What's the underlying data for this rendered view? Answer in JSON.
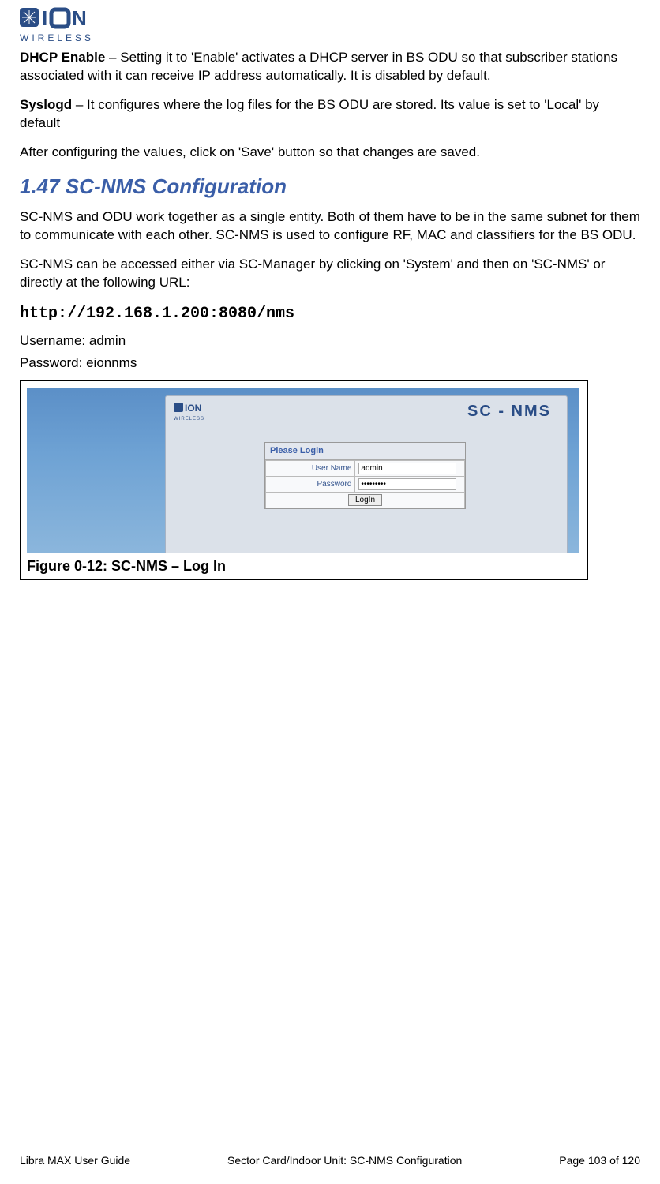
{
  "logo": {
    "brand_top": "EION",
    "brand_sub": "WIRELESS"
  },
  "body": {
    "p1_bold": "DHCP Enable",
    "p1_rest": " – Setting it to 'Enable' activates a DHCP server in BS ODU so that subscriber stations associated with it can receive IP address automatically. It is disabled by default.",
    "p2_bold": "Syslogd",
    "p2_rest": " – It configures where the log files for the BS ODU are stored. Its value is set to 'Local' by default",
    "p3": "After configuring the values, click on 'Save' button so that changes are saved.",
    "h2": "1.47 SC-NMS Configuration",
    "p4": "SC-NMS and ODU work together as a single entity. Both of them have to be in the same subnet for them to communicate with each other. SC-NMS is used to configure RF, MAC and classifiers for the BS ODU.",
    "p5": "SC-NMS can be accessed either via SC-Manager by clicking on 'System' and then on 'SC-NMS' or directly at the following URL:",
    "url": "http://192.168.1.200:8080/nms",
    "username_line": "Username: admin",
    "password_line": "Password: eionnms"
  },
  "figure": {
    "caption": "Figure 0-12: SC-NMS – Log In",
    "panel_title": "SC - NMS",
    "login_title": "Please Login",
    "user_label": "User Name",
    "pass_label": "Password",
    "user_value": "admin",
    "pass_value": "•••••••••",
    "login_btn": "LogIn"
  },
  "footer": {
    "left": "Libra MAX User Guide",
    "center": "Sector Card/Indoor Unit: SC-NMS Configuration",
    "right": "Page 103 of 120"
  }
}
